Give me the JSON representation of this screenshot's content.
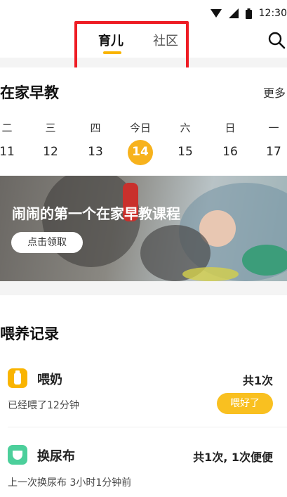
{
  "status_bar": {
    "time": "12:30"
  },
  "header": {
    "tabs": [
      {
        "label": "育儿",
        "active": true
      },
      {
        "label": "社区",
        "active": false
      }
    ],
    "search_icon": "search-icon"
  },
  "early_ed": {
    "title": "在家早教",
    "more_label": "更多",
    "weekdays": [
      "二",
      "三",
      "四",
      "今日",
      "六",
      "日",
      "一"
    ],
    "dates": [
      "11",
      "12",
      "13",
      "14",
      "15",
      "16",
      "17"
    ],
    "selected_date": "14",
    "banner": {
      "title": "闹闹的第一个在家早教课程",
      "button": "点击领取"
    }
  },
  "feeding": {
    "title": "喂养记录",
    "records": [
      {
        "icon": "bottle-icon",
        "label": "喂奶",
        "count": "共1次",
        "sub": "已经喂了12分钟",
        "button": "喂好了"
      },
      {
        "icon": "diaper-icon",
        "label": "换尿布",
        "count": "共1次, 1次便便",
        "sub": "上一次换尿布 3小时1分钟前"
      }
    ]
  },
  "colors": {
    "accent": "#f9b400",
    "highlight_border": "#ee1c24",
    "diaper_green": "#4ccf9b"
  }
}
